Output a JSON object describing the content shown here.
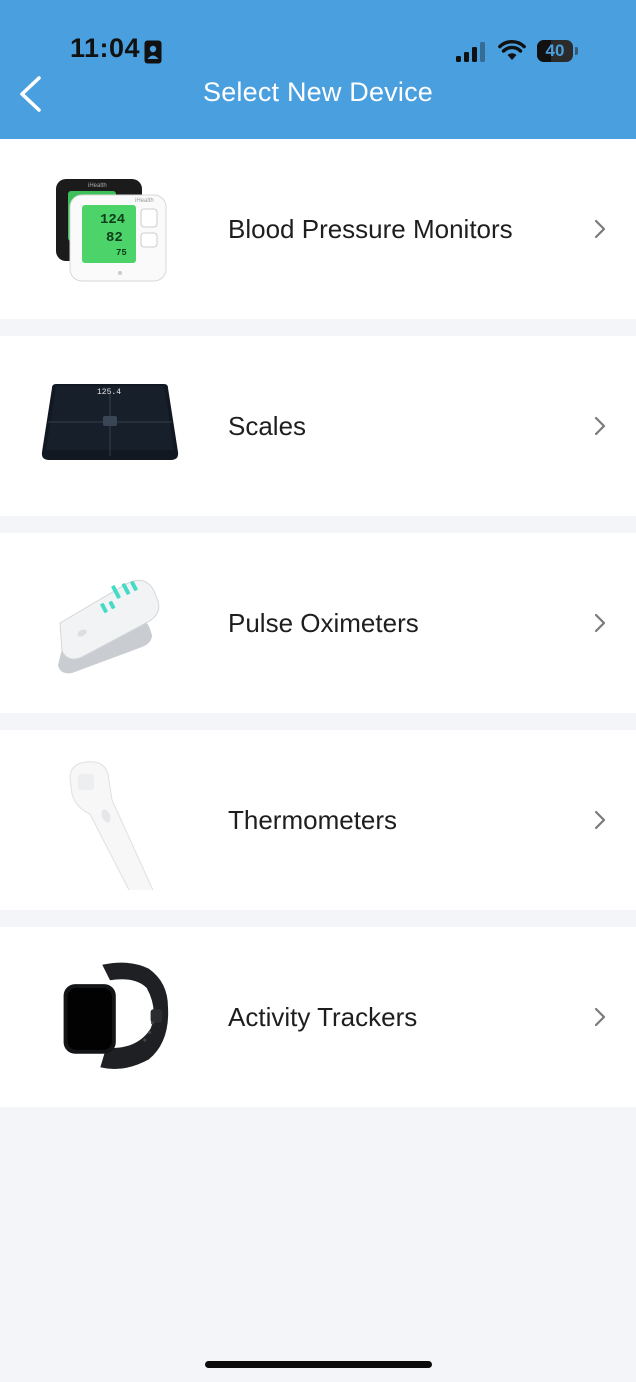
{
  "status_bar": {
    "time": "11:04",
    "battery_level": "40",
    "battery_fraction": 0.4,
    "icons": [
      "id-card-icon",
      "cellular-signal-icon",
      "wifi-icon",
      "battery-icon"
    ]
  },
  "header": {
    "title": "Select New Device",
    "back_icon": "chevron-left-icon",
    "background": "#4a9fdf"
  },
  "devices": [
    {
      "label": "Blood Pressure Monitors",
      "icon": "blood-pressure-monitor-image"
    },
    {
      "label": "Scales",
      "icon": "scale-image"
    },
    {
      "label": "Pulse Oximeters",
      "icon": "pulse-oximeter-image"
    },
    {
      "label": "Thermometers",
      "icon": "thermometer-image"
    },
    {
      "label": "Activity Trackers",
      "icon": "activity-tracker-image"
    }
  ],
  "device_images": {
    "bp_monitor": {
      "brand": "iHealth",
      "readings": [
        "124",
        "82",
        "75"
      ]
    },
    "scale": {
      "reading": "125.4"
    }
  },
  "colors": {
    "accent": "#4a9fdf",
    "list_background": "#f3f5f9",
    "row_background": "#ffffff",
    "chevron": "#7a7a7a"
  }
}
